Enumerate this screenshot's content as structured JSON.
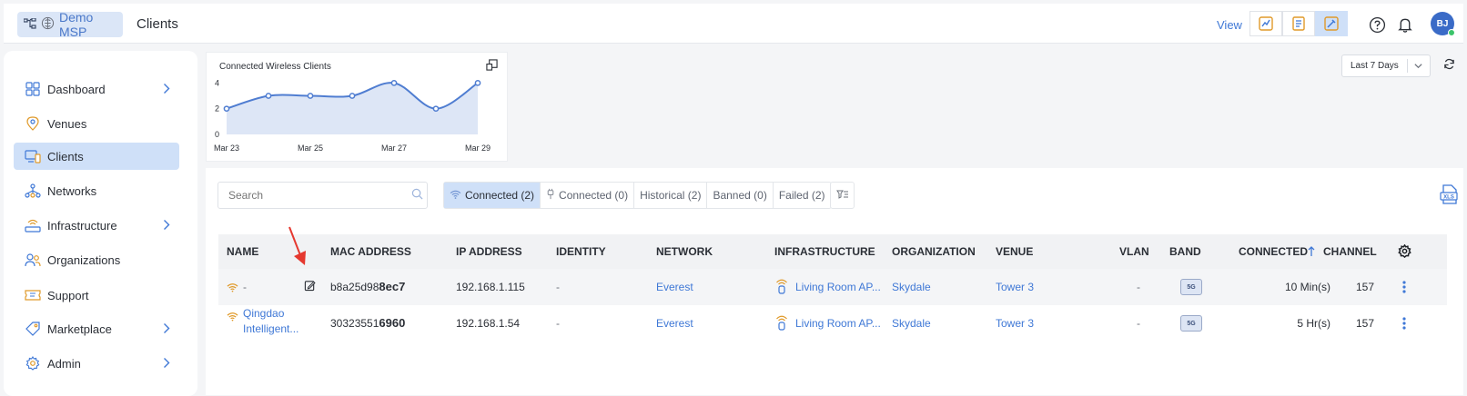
{
  "header": {
    "brand": "Demo MSP",
    "page_title": "Clients",
    "view_label": "View",
    "avatar_initials": "BJ",
    "colors": {
      "accent": "#3f78d6",
      "active_bg": "#cfe0f8",
      "online": "#3cc46b"
    }
  },
  "sidebar": {
    "items": [
      {
        "label": "Dashboard",
        "icon": "grid-icon",
        "has_chevron": true
      },
      {
        "label": "Venues",
        "icon": "location-pin-icon",
        "has_chevron": false
      },
      {
        "label": "Clients",
        "icon": "devices-icon",
        "has_chevron": false,
        "active": true
      },
      {
        "label": "Networks",
        "icon": "network-icon",
        "has_chevron": false
      },
      {
        "label": "Infrastructure",
        "icon": "router-icon",
        "has_chevron": true
      },
      {
        "label": "Organizations",
        "icon": "users-icon",
        "has_chevron": false
      },
      {
        "label": "Support",
        "icon": "ticket-icon",
        "has_chevron": false
      },
      {
        "label": "Marketplace",
        "icon": "tag-icon",
        "has_chevron": true
      },
      {
        "label": "Admin",
        "icon": "gear-icon",
        "has_chevron": true
      }
    ]
  },
  "chart_data": {
    "type": "area",
    "title": "Connected Wireless Clients",
    "x": [
      "Mar 23",
      "Mar 24",
      "Mar 25",
      "Mar 26",
      "Mar 27",
      "Mar 28",
      "Mar 29"
    ],
    "x_tick_labels": [
      "Mar 23",
      "Mar 25",
      "Mar 27",
      "Mar 29"
    ],
    "values": [
      2,
      3,
      3,
      3,
      4,
      2,
      4
    ],
    "y_ticks": [
      0,
      2,
      4
    ],
    "ylim": [
      0,
      4.8
    ],
    "grid": false,
    "line_color": "#4f7dd1",
    "fill_color": "#dde6f6"
  },
  "controls": {
    "range": "Last 7 Days",
    "search_placeholder": "Search",
    "tabs": [
      {
        "label": "Connected (2)",
        "icon": "wifi-icon",
        "active": true
      },
      {
        "label": "Connected (0)",
        "icon": "plug-icon",
        "active": false
      },
      {
        "label": "Historical (2)",
        "active": false
      },
      {
        "label": "Banned (0)",
        "active": false
      },
      {
        "label": "Failed (2)",
        "active": false
      }
    ]
  },
  "table": {
    "columns": [
      "NAME",
      "MAC ADDRESS",
      "IP ADDRESS",
      "IDENTITY",
      "NETWORK",
      "INFRASTRUCTURE",
      "ORGANIZATION",
      "VENUE",
      "VLAN",
      "BAND",
      "CONNECTED",
      "CHANNEL"
    ],
    "rows": [
      {
        "name": "-",
        "name_line2": "",
        "mac_prefix": "b8a25d98",
        "mac_suffix": "8ec7",
        "ip": "192.168.1.115",
        "identity": "-",
        "network": "Everest",
        "infrastructure": "Living Room AP...",
        "organization": "Skydale",
        "venue": "Tower 3",
        "vlan": "-",
        "band": "5G",
        "connected": "10 Min(s)",
        "channel": "157"
      },
      {
        "name": "Qingdao",
        "name_line2": "Intelligent...",
        "mac_prefix": "30323551",
        "mac_suffix": "6960",
        "ip": "192.168.1.54",
        "identity": "-",
        "network": "Everest",
        "infrastructure": "Living Room AP...",
        "organization": "Skydale",
        "venue": "Tower 3",
        "vlan": "-",
        "band": "5G",
        "connected": "5 Hr(s)",
        "channel": "157"
      }
    ]
  }
}
